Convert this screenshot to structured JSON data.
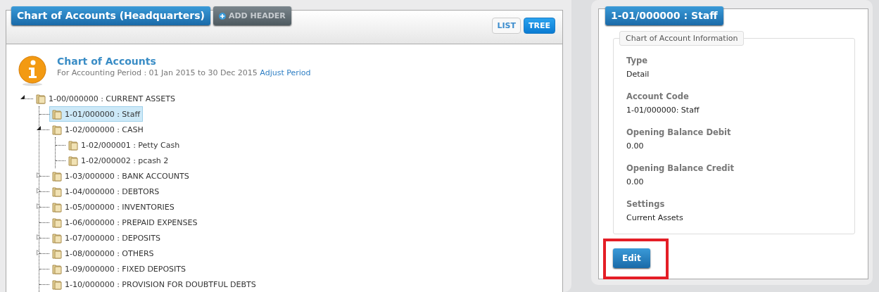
{
  "left_panel": {
    "title": "Chart of Accounts (Headquarters)",
    "add_button": "ADD HEADER",
    "view_tabs": [
      {
        "label": "LIST",
        "selected": false
      },
      {
        "label": "TREE",
        "selected": true
      }
    ],
    "heading": "Chart of Accounts",
    "period": "For Accounting Period : 01 Jan 2015 to 30 Dec 2015",
    "period_link": "Adjust Period",
    "tree": [
      {
        "label": "1-00/000000 : CURRENT ASSETS",
        "selected": false,
        "expanded": true,
        "children": [
          {
            "label": "1-01/000000 : Staff",
            "selected": true
          },
          {
            "label": "1-02/000000 : CASH",
            "selected": false,
            "expanded": true,
            "children": [
              {
                "label": "1-02/000001 : Petty Cash",
                "selected": false
              },
              {
                "label": "1-02/000002 : pcash 2",
                "selected": false
              }
            ]
          },
          {
            "label": "1-03/000000 : BANK ACCOUNTS",
            "selected": false,
            "expanded": false
          },
          {
            "label": "1-04/000000 : DEBTORS",
            "selected": false,
            "expanded": false
          },
          {
            "label": "1-05/000000 : INVENTORIES",
            "selected": false,
            "expanded": false
          },
          {
            "label": "1-06/000000 : PREPAID EXPENSES",
            "selected": false
          },
          {
            "label": "1-07/000000 : DEPOSITS",
            "selected": false,
            "expanded": false
          },
          {
            "label": "1-08/000000 : OTHERS",
            "selected": false,
            "expanded": false
          },
          {
            "label": "1-09/000000 : FIXED DEPOSITS",
            "selected": false
          },
          {
            "label": "1-10/000000 : PROVISION FOR DOUBTFUL DEBTS",
            "selected": false
          }
        ]
      }
    ]
  },
  "right_panel": {
    "title": "1-01/000000 : Staff",
    "group_title": "Chart of Account Information",
    "fields": [
      {
        "label": "Type",
        "value": "Detail"
      },
      {
        "label": "Account Code",
        "value": "1-01/000000: Staff"
      },
      {
        "label": "Opening Balance Debit",
        "value": "0.00"
      },
      {
        "label": "Opening Balance Credit",
        "value": "0.00"
      },
      {
        "label": "Settings",
        "value": "Current Assets"
      }
    ],
    "edit_button": {
      "label": "Edit",
      "highlighted": true
    }
  }
}
